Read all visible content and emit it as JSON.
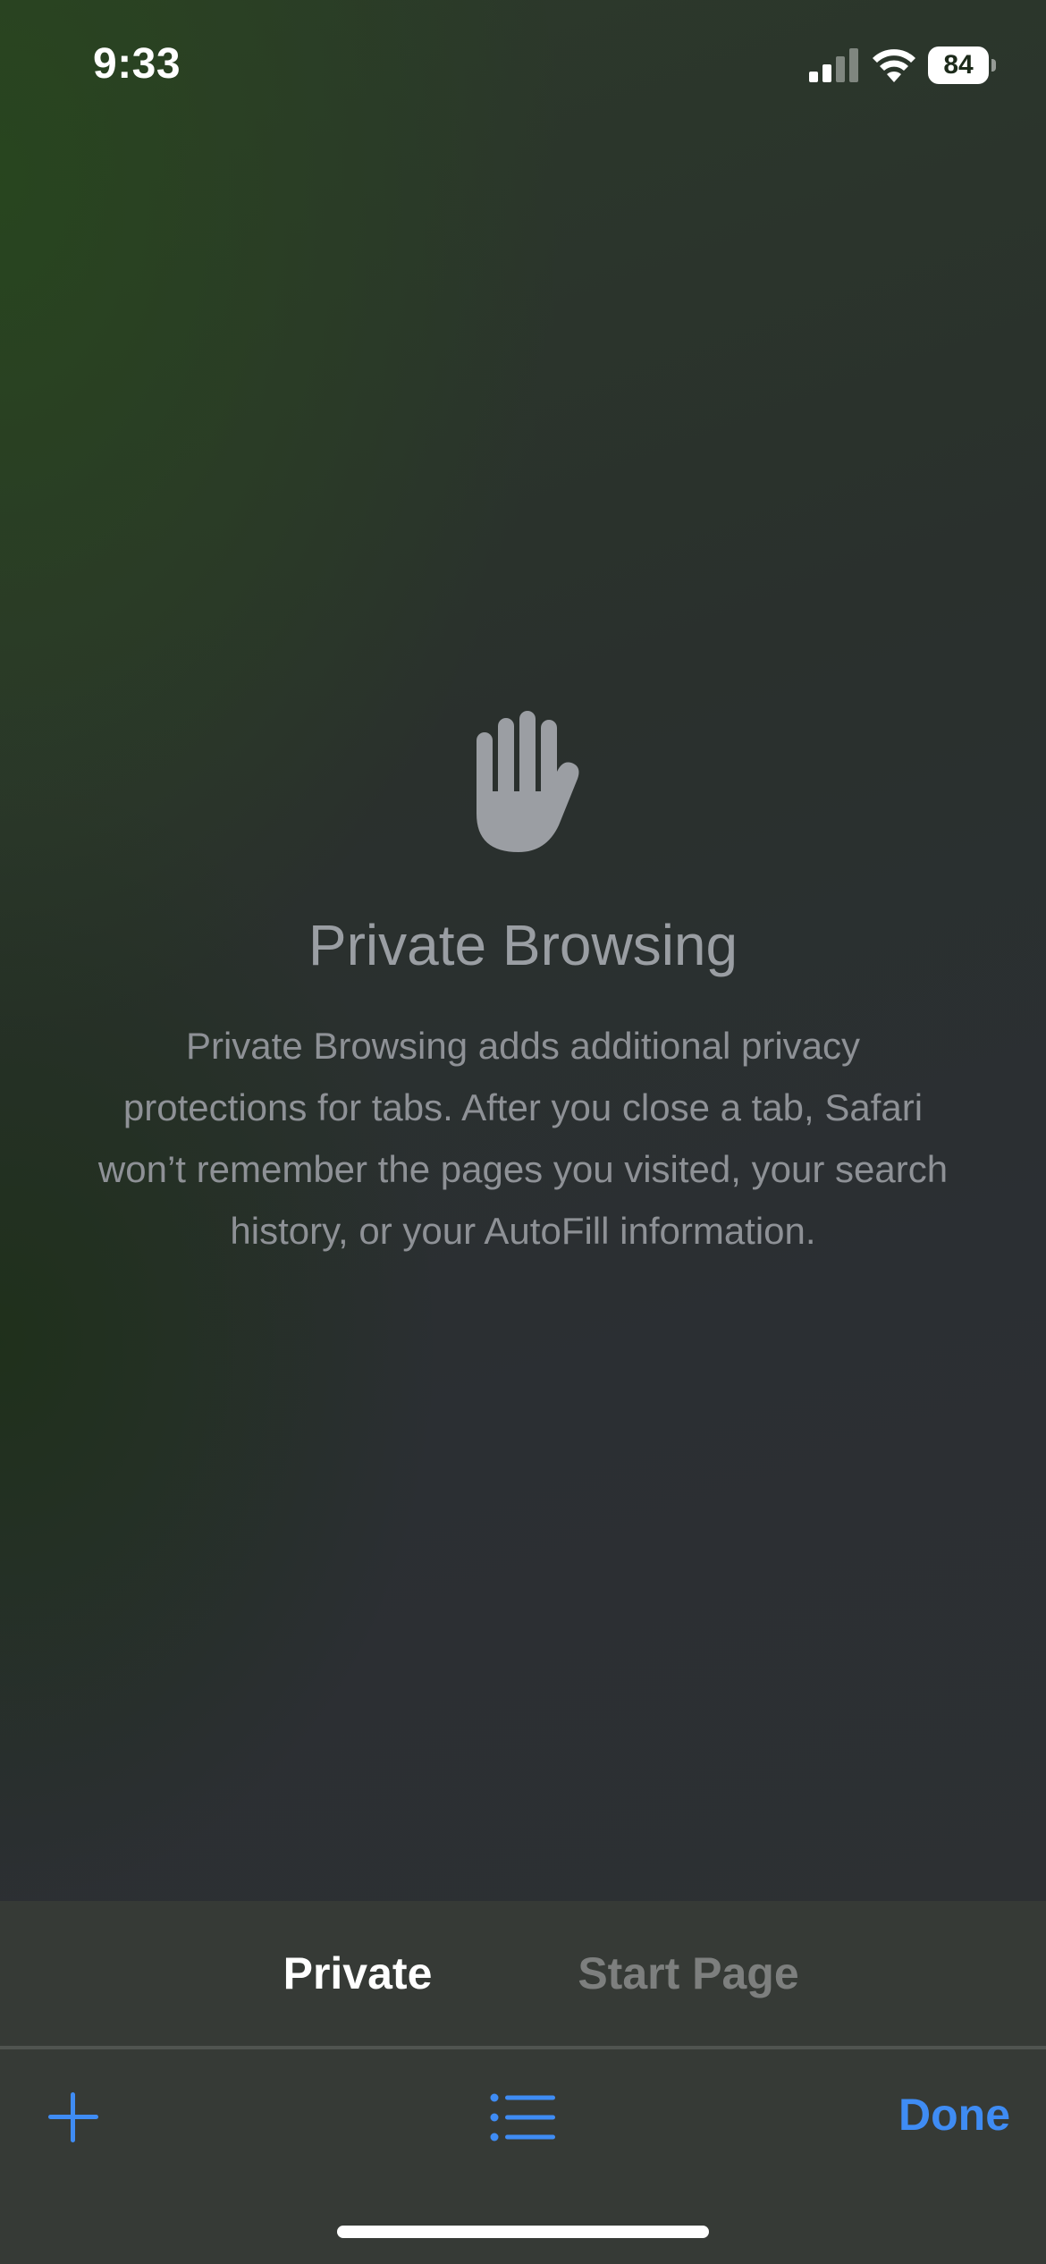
{
  "status_bar": {
    "time": "9:33",
    "battery_level": "84",
    "icons": [
      "signal-icon",
      "wifi-icon",
      "battery-icon"
    ]
  },
  "main": {
    "icon": "hand-raised-icon",
    "title": "Private Browsing",
    "description": "Private Browsing adds additional privacy protections for tabs. After you close a tab, Safari won’t remember the pages you visited, your search history, or your AutoFill information."
  },
  "tab_groups": {
    "items": [
      {
        "label": "Private",
        "selected": true
      },
      {
        "label": "Start Page",
        "selected": false
      }
    ]
  },
  "toolbar": {
    "new_tab_icon": "plus-icon",
    "tab_groups_icon": "list-icon",
    "done_label": "Done"
  },
  "colors": {
    "accent": "#3f8cf4",
    "title_text": "#9a9ea3",
    "body_text": "#8e9196",
    "unselected_tab": "#7d7f7e"
  }
}
